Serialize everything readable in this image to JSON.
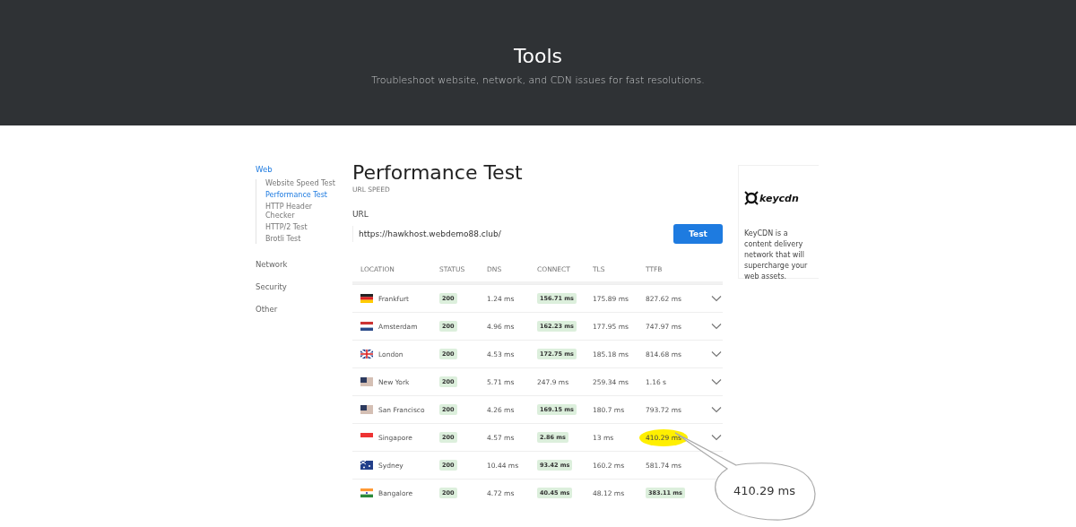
{
  "hero": {
    "title": "Tools",
    "subtitle": "Troubleshoot website, network, and CDN issues for fast resolutions."
  },
  "sidebar": {
    "groups": [
      {
        "label": "Web",
        "selected": true,
        "children": [
          {
            "label": "Website Speed Test",
            "selected": false
          },
          {
            "label": "Performance Test",
            "selected": true
          },
          {
            "label": "HTTP Header Checker",
            "selected": false
          },
          {
            "label": "HTTP/2 Test",
            "selected": false
          },
          {
            "label": "Brotli Test",
            "selected": false
          }
        ]
      },
      {
        "label": "Network",
        "selected": false
      },
      {
        "label": "Security",
        "selected": false
      },
      {
        "label": "Other",
        "selected": false
      }
    ]
  },
  "main": {
    "title": "Performance Test",
    "subtitle": "URL SPEED",
    "url_label": "URL",
    "url_value": "https://hawkhost.webdemo88.club/",
    "test_button": "Test"
  },
  "table": {
    "columns": [
      "LOCATION",
      "STATUS",
      "DNS",
      "CONNECT",
      "TLS",
      "TTFB"
    ],
    "rows": [
      {
        "flag": {
          "kind": "de"
        },
        "location": "Frankfurt",
        "status": "200",
        "dns": "1.24 ms",
        "connect": {
          "text": "156.71 ms",
          "fast": true
        },
        "tls": "175.89 ms",
        "ttfb": {
          "text": "827.62 ms",
          "fast": false,
          "marked": false
        },
        "expandable": true
      },
      {
        "flag": {
          "kind": "nl"
        },
        "location": "Amsterdam",
        "status": "200",
        "dns": "4.96 ms",
        "connect": {
          "text": "162.23 ms",
          "fast": true
        },
        "tls": "177.95 ms",
        "ttfb": {
          "text": "747.97 ms",
          "fast": false,
          "marked": false
        },
        "expandable": true
      },
      {
        "flag": {
          "kind": "gb"
        },
        "location": "London",
        "status": "200",
        "dns": "4.53 ms",
        "connect": {
          "text": "172.75 ms",
          "fast": true
        },
        "tls": "185.18 ms",
        "ttfb": {
          "text": "814.68 ms",
          "fast": false,
          "marked": false
        },
        "expandable": true
      },
      {
        "flag": {
          "kind": "us"
        },
        "location": "New York",
        "status": "200",
        "dns": "5.71 ms",
        "connect": {
          "text": "247.9 ms",
          "fast": false
        },
        "tls": "259.34 ms",
        "ttfb": {
          "text": "1.16 s",
          "fast": false,
          "marked": false
        },
        "expandable": true
      },
      {
        "flag": {
          "kind": "us"
        },
        "location": "San Francisco",
        "status": "200",
        "dns": "4.26 ms",
        "connect": {
          "text": "169.15 ms",
          "fast": true
        },
        "tls": "180.7 ms",
        "ttfb": {
          "text": "793.72 ms",
          "fast": false,
          "marked": false
        },
        "expandable": true
      },
      {
        "flag": {
          "kind": "sg"
        },
        "location": "Singapore",
        "status": "200",
        "dns": "4.57 ms",
        "connect": {
          "text": "2.86 ms",
          "fast": true
        },
        "tls": "13 ms",
        "ttfb": {
          "text": "410.29 ms",
          "fast": false,
          "marked": true
        },
        "expandable": true
      },
      {
        "flag": {
          "kind": "au"
        },
        "location": "Sydney",
        "status": "200",
        "dns": "10.44 ms",
        "connect": {
          "text": "93.42 ms",
          "fast": true
        },
        "tls": "160.2 ms",
        "ttfb": {
          "text": "581.74 ms",
          "fast": false,
          "marked": false
        },
        "expandable": false
      },
      {
        "flag": {
          "kind": "in"
        },
        "location": "Bangalore",
        "status": "200",
        "dns": "4.72 ms",
        "connect": {
          "text": "40.45 ms",
          "fast": true
        },
        "tls": "48.12 ms",
        "ttfb": {
          "text": "383.11 ms",
          "fast": true,
          "marked": false
        },
        "expandable": false
      }
    ]
  },
  "callout": {
    "text": "410.29 ms"
  },
  "ad": {
    "logo": "keycdn",
    "text": "KeyCDN is a content delivery network that will supercharge your web assets."
  }
}
